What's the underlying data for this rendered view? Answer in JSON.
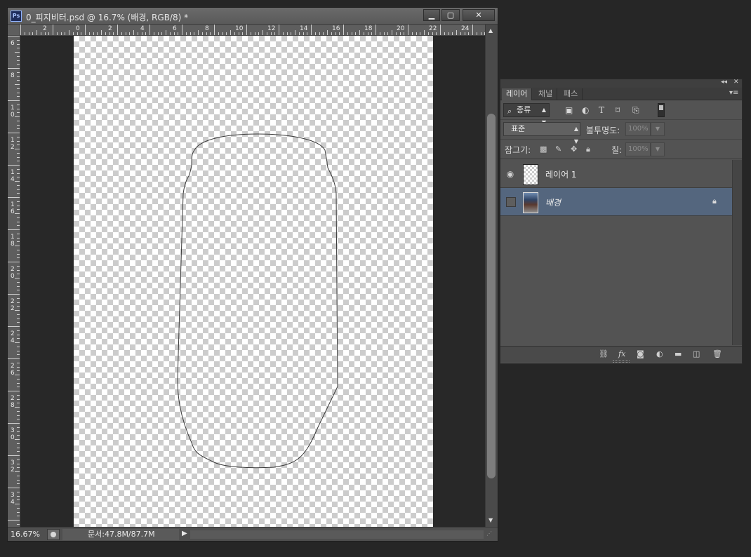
{
  "document": {
    "title": "0_피지비터.psd @ 16.7% (배경, RGB/8) *",
    "app_icon": "Ps",
    "window_buttons": {
      "minimize": "▁",
      "maximize": "▢",
      "close": "✕"
    },
    "ruler_h": [
      {
        "label": "2"
      },
      {
        "label": "0"
      },
      {
        "label": "2"
      },
      {
        "label": "4"
      },
      {
        "label": "6"
      },
      {
        "label": "8"
      },
      {
        "label": "10"
      },
      {
        "label": "12"
      },
      {
        "label": "14"
      },
      {
        "label": "16"
      },
      {
        "label": "18"
      },
      {
        "label": "20"
      },
      {
        "label": "22"
      },
      {
        "label": "24"
      }
    ],
    "ruler_v": [
      "6",
      "8",
      "10",
      "12",
      "14",
      "16",
      "18",
      "20",
      "22",
      "24",
      "26",
      "28",
      "30",
      "32",
      "34"
    ],
    "status": {
      "zoom": "16.67%",
      "doc_size": "문서:47.8M/87.7M",
      "arrow": "▶"
    }
  },
  "layers_panel": {
    "tabs": [
      {
        "label": "레이어",
        "active": true
      },
      {
        "label": "채널",
        "active": false
      },
      {
        "label": "패스",
        "active": false
      }
    ],
    "filter": {
      "label": "종류",
      "icons": [
        "image-filter-icon",
        "adjustment-filter-icon",
        "type-filter-icon",
        "shape-filter-icon",
        "smart-object-filter-icon"
      ]
    },
    "blend_mode": "표준",
    "opacity_label": "불투명도:",
    "opacity_value": "100%",
    "lock_label": "잠그기:",
    "fill_label": "칠:",
    "fill_value": "100%",
    "layers": [
      {
        "name": "레이어 1",
        "visible": true,
        "selected": false,
        "locked": false
      },
      {
        "name": "배경",
        "visible": false,
        "selected": true,
        "locked": true
      }
    ],
    "footer_icons": [
      "link-layers-icon",
      "fx-icon",
      "add-mask-icon",
      "adjustment-layer-icon",
      "new-group-icon",
      "new-layer-icon",
      "delete-layer-icon"
    ]
  }
}
